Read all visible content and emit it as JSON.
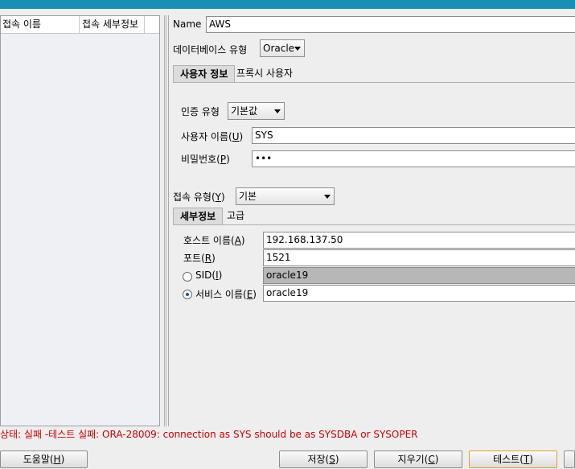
{
  "left": {
    "columns": [
      "접속 이름",
      "접속 세부정보"
    ]
  },
  "form": {
    "name_label": "Name",
    "name_value": "AWS",
    "db_type_label": "데이터베이스 유형",
    "db_type_value": "Oracle",
    "tabs": [
      {
        "label": "사용자 정보",
        "active": true
      },
      {
        "label": "프록시 사용자",
        "active": false
      }
    ],
    "auth_type_label": "인증 유형",
    "auth_type_value": "기본값",
    "username_label_prefix": "사용자 이름(",
    "username_label_key": "U",
    "username_label_suffix": ")",
    "username_value": "SYS",
    "password_label_prefix": "비밀번호(",
    "password_label_key": "P",
    "password_label_suffix": ")",
    "password_value": "•••",
    "conn_type_label_prefix": "접속 유형(",
    "conn_type_label_key": "Y",
    "conn_type_label_suffix": ")",
    "conn_type_value": "기본",
    "detail_tabs": [
      {
        "label": "세부정보",
        "active": true
      },
      {
        "label": "고급",
        "active": false
      }
    ],
    "host_label_prefix": "호스트 이름(",
    "host_label_key": "A",
    "host_label_suffix": ")",
    "host_value": "192.168.137.50",
    "port_label_prefix": "포트(",
    "port_label_key": "R",
    "port_label_suffix": ")",
    "port_value": "1521",
    "sid_label_prefix": "SID(",
    "sid_label_key": "I",
    "sid_label_suffix": ")",
    "sid_value": "oracle19",
    "service_label_prefix": "서비스 이름(",
    "service_label_key": "E",
    "service_label_suffix": ")",
    "service_value": "oracle19"
  },
  "status_text": "상태: 실패 -테스트 실패: ORA-28009: connection as SYS should be as SYSDBA or SYSOPER",
  "buttons": {
    "help_prefix": "도움말(",
    "help_key": "H",
    "help_suffix": ")",
    "save_prefix": "저장(",
    "save_key": "S",
    "save_suffix": ")",
    "clear_prefix": "지우기(",
    "clear_key": "C",
    "clear_suffix": ")",
    "test_prefix": "테스트(",
    "test_key": "T",
    "test_suffix": ")"
  },
  "colors": {
    "title_bar": "#1a8fb5",
    "status_error": "#cc0000",
    "disabled_field": "#b7b7b7"
  }
}
